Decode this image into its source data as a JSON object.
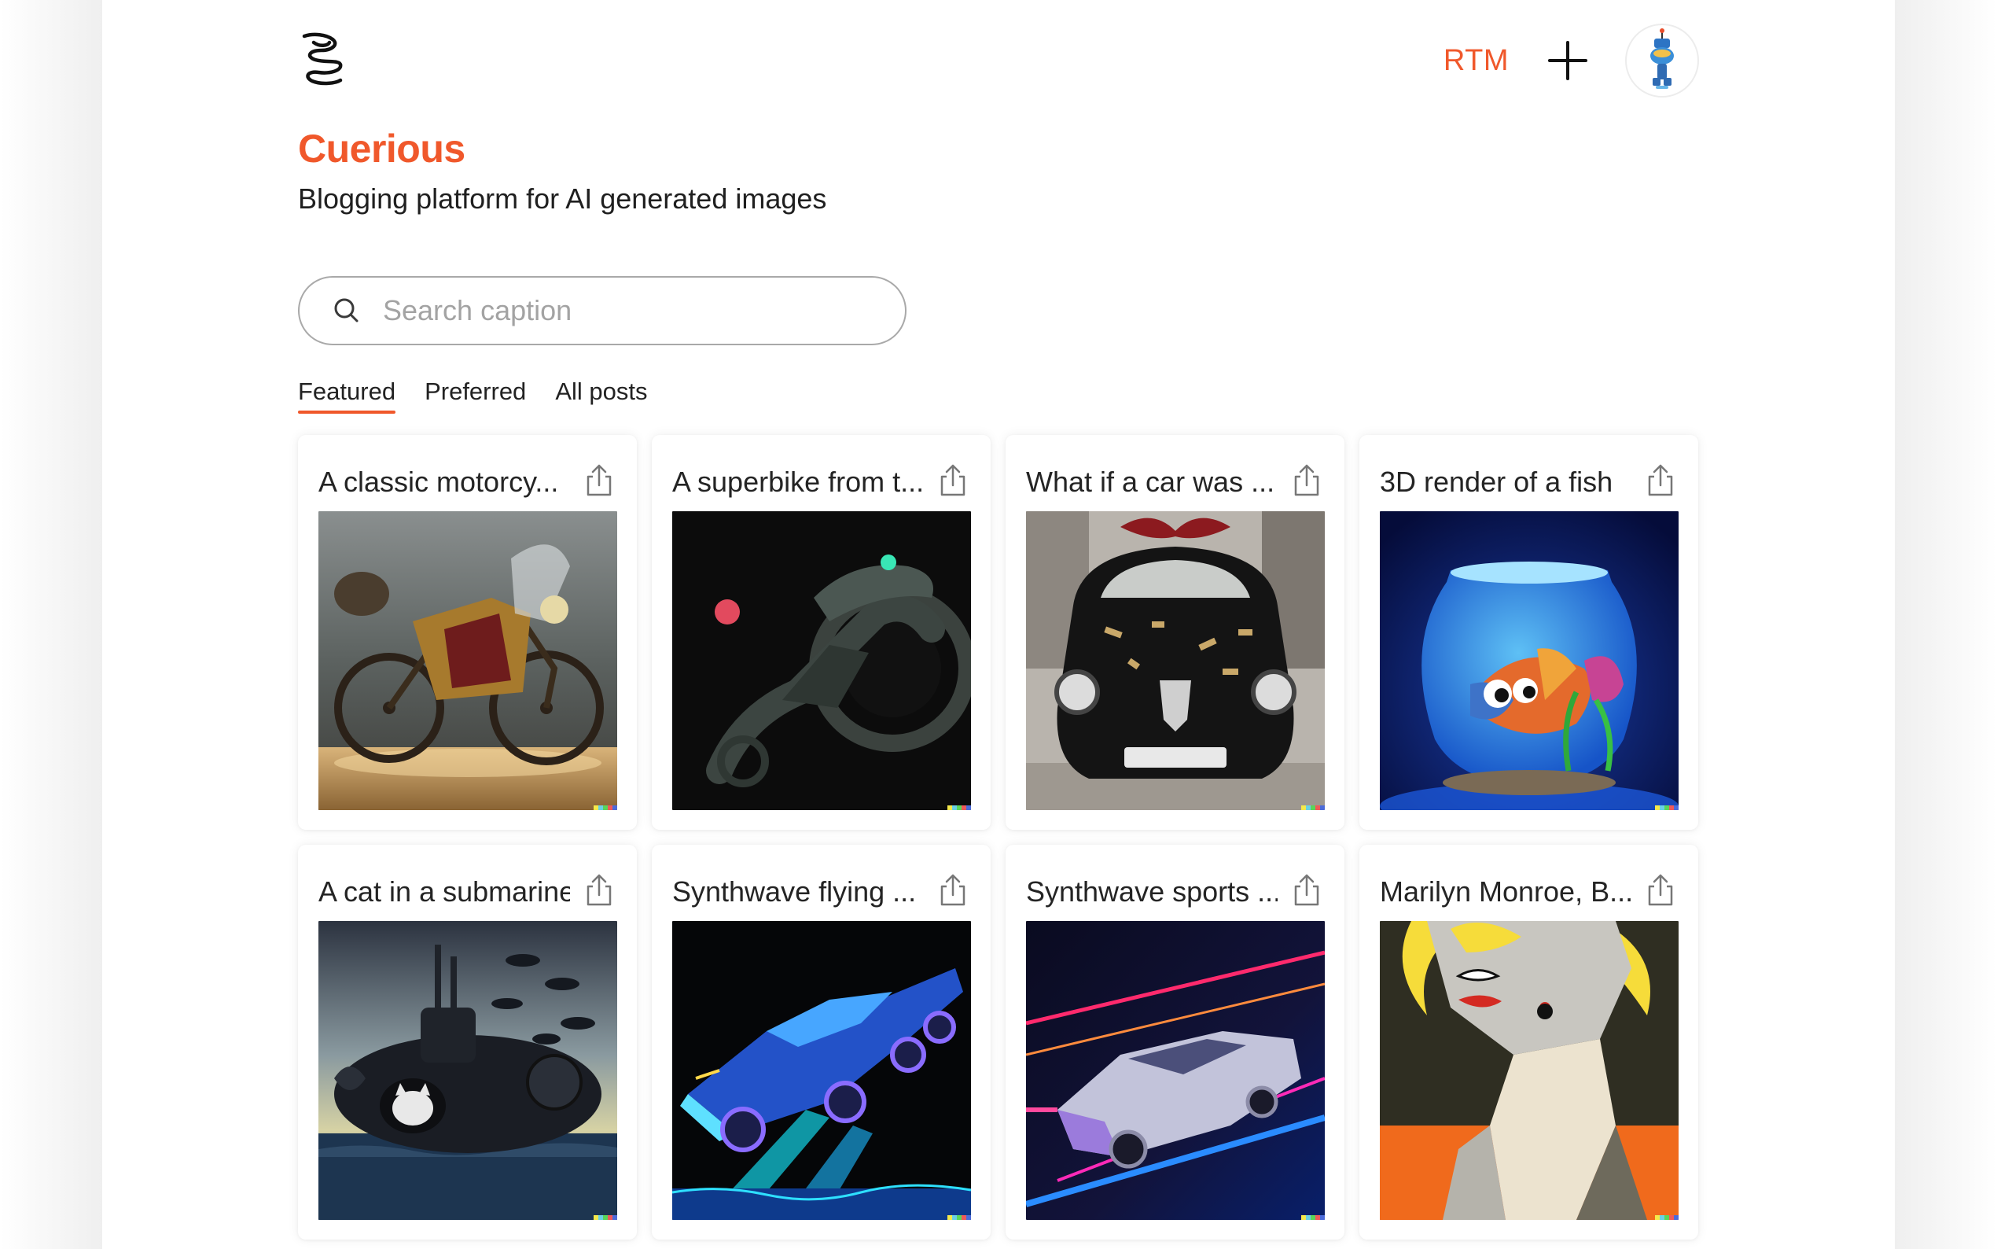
{
  "header": {
    "rtm_label": "RTM",
    "logo_icon": "spiral-logo-icon",
    "add_icon": "plus-icon",
    "avatar_icon": "robot-avatar-icon"
  },
  "brand": {
    "title": "Cuerious",
    "subtitle": "Blogging platform for AI generated images",
    "accent_color": "#f0582b"
  },
  "search": {
    "placeholder": "Search caption",
    "value": ""
  },
  "tabs": [
    {
      "label": "Featured",
      "active": true
    },
    {
      "label": "Preferred",
      "active": false
    },
    {
      "label": "All posts",
      "active": false
    }
  ],
  "posts": [
    {
      "caption": "A classic motorcy...",
      "image": "vintage-motorcycle-image",
      "share_icon": "share-icon"
    },
    {
      "caption": "A superbike from t...",
      "image": "futuristic-superbike-image",
      "share_icon": "share-icon"
    },
    {
      "caption": "What if a car was ...",
      "image": "gift-car-image",
      "share_icon": "share-icon"
    },
    {
      "caption": "3D render of a fish",
      "image": "fish-bowl-image",
      "share_icon": "share-icon"
    },
    {
      "caption": "A cat in a submarine",
      "image": "cat-submarine-image",
      "share_icon": "share-icon"
    },
    {
      "caption": "Synthwave flying ...",
      "image": "synthwave-flying-car-image",
      "share_icon": "share-icon"
    },
    {
      "caption": "Synthwave sports ...",
      "image": "synthwave-sports-car-image",
      "share_icon": "share-icon"
    },
    {
      "caption": "Marilyn Monroe, B...",
      "image": "marilyn-cubist-portrait-image",
      "share_icon": "share-icon"
    }
  ]
}
